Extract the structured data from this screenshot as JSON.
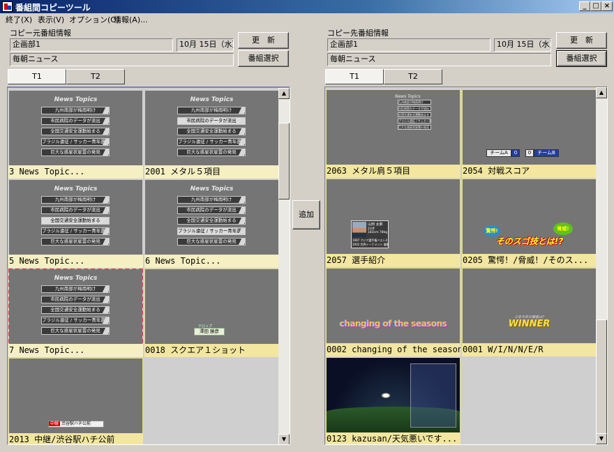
{
  "window": {
    "title": "番組間コピーツール",
    "min": "_",
    "max": "□",
    "close": "×"
  },
  "menu": [
    {
      "label": "終了(X)"
    },
    {
      "label": "表示(V)"
    },
    {
      "label": "オプション(O)"
    },
    {
      "label": "情報(A)..."
    }
  ],
  "left": {
    "section_label": "コピー元番組情報",
    "dept": "企画部1",
    "date": "10月 15日（水）",
    "program": "毎朝ニュース",
    "update_button": "更　新",
    "select_button": "番組選択",
    "tabs": [
      {
        "label": "T1",
        "active": true
      },
      {
        "label": "T2",
        "active": false
      }
    ],
    "cells": [
      {
        "caption": "3  News Topic...",
        "kind": "news",
        "hl": -1
      },
      {
        "caption": "2001 メタル５項目",
        "kind": "news",
        "hl": 1
      },
      {
        "caption": "5  News Topic...",
        "kind": "news",
        "hl": 2
      },
      {
        "caption": "6  News Topic...",
        "kind": "news",
        "hl": 3
      },
      {
        "caption": "7  News Topic...",
        "kind": "news",
        "hl": -1,
        "selected": true
      },
      {
        "caption": "0018 スクエア１ショット",
        "kind": "name",
        "yellow": true
      },
      {
        "caption": "2013 中継/渋谷駅ハチ公前",
        "kind": "chukei",
        "yellow": true
      }
    ]
  },
  "news_topics": {
    "title": "News Topics",
    "items": [
      "九州南部が梅雨明け",
      "市民病院のデータが流出",
      "全国交通安全運動始まる",
      "ブラジル遠征 / サッカー青年選手権",
      "巨大な惑星状星雲の発見"
    ]
  },
  "thumb_text": {
    "name_small": "テロップ",
    "name_main": "澤田 勝彦",
    "chukei_tag": "中継",
    "chukei_text": "渋谷駅ハチ公前",
    "team_a": "チームA",
    "score_a": "0",
    "score_b": "0",
    "team_b": "チームB",
    "player_name": "山田 太郎",
    "player_stats": [
      "23才",
      "183cm 78kg"
    ],
    "player_career": [
      "1997 アジア選手権ベスト4",
      "2002 世界トーナメント 優勝"
    ],
    "surprise_1": "驚愕!",
    "surprise_2": "脅威!",
    "surprise_main": "そのスゴ技とは!?",
    "seasons": "changing of the seasons",
    "winner_small": "さあ今年の勝者は?",
    "winner": "WINNER"
  },
  "add_button": "追加",
  "right": {
    "section_label": "コピー先番組情報",
    "dept": "企画部1",
    "date": "10月 15日（水）",
    "program": "毎朝ニュース",
    "update_button": "更　新",
    "select_button": "番組選択",
    "tabs": [
      {
        "label": "T1",
        "active": true
      },
      {
        "label": "T2",
        "active": false
      }
    ],
    "cells": [
      {
        "caption": "2063 メタル肩５項目",
        "kind": "smallnews"
      },
      {
        "caption": "2054 対戦スコア",
        "kind": "score"
      },
      {
        "caption": "2057 選手紹介",
        "kind": "player"
      },
      {
        "caption": "0205 驚愕！/脅威！/そのス...",
        "kind": "surprise"
      },
      {
        "caption": "0002 changing of the seasons",
        "kind": "seasons"
      },
      {
        "caption": "0001 W/I/N/N/E/R",
        "kind": "winner"
      },
      {
        "caption": "0123 kazusan/天気悪いです...",
        "kind": "photo"
      }
    ]
  },
  "colors": {
    "titlebar_start": "#0a246a",
    "caption_bg": "#f5efc2",
    "selected_border": "#e04040",
    "yellow_frame": "#e6d88a"
  }
}
